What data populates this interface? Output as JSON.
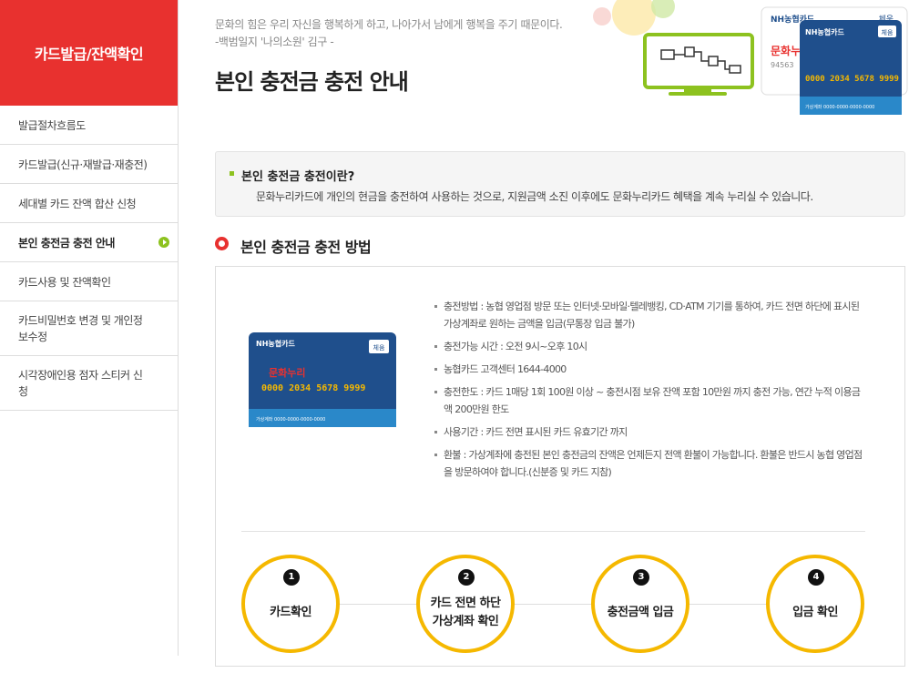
{
  "sidebar": {
    "title": "카드발급/잔액확인",
    "items": [
      {
        "label": "발급절차흐름도"
      },
      {
        "label": "카드발급(신규·재발급·재충전)"
      },
      {
        "label": "세대별 카드 잔액 합산 신청"
      },
      {
        "label": "본인 충전금 충전 안내"
      },
      {
        "label": "카드사용 및 잔액확인"
      },
      {
        "label": "카드비밀번호 변경 및 개인정보수정"
      },
      {
        "label": "시각장애인용 점자 스티커 신청"
      }
    ]
  },
  "header": {
    "quote_line1": "문화의 힘은 우리 자신을 행복하게 하고, 나아가서 남에게 행복을 주기 때문이다.",
    "quote_line2": "-백범일지 '나의소원' 김구 -",
    "page_title": "본인 충전금 충전 안내"
  },
  "hero": {
    "card_bank": "NH농협카드",
    "card_brand": "문화누리",
    "card_number": "0000 2034 5678 9999",
    "card_chip": "체움",
    "card_sub": "가상계좌 0000-0000-0000-0000",
    "back_number": "94563"
  },
  "intro": {
    "question": "본인 충전금 충전이란?",
    "answer": "문화누리카드에 개인의 현금을 충전하여 사용하는 것으로, 지원금액 소진 이후에도 문화누리카드 혜택을 계속 누리실 수 있습니다."
  },
  "section": {
    "title": "본인 충전금 충전 방법"
  },
  "card": {
    "bank": "NH농협카드",
    "brand": "문화누리",
    "number": "0000 2034 5678 9999",
    "chip": "체움",
    "sub": "가상계좌 0000-0000-0000-0000"
  },
  "bullets": [
    "충전방법 : 농협 영업점 방문 또는 인터넷·모바일·텔레뱅킹, CD·ATM 기기를 통하여, 카드 전면 하단에 표시된 가상계좌로 원하는 금액을 입금(무통장 입금 불가)",
    "충전가능 시간 : 오전 9시~오후 10시",
    "농협카드 고객센터 1644-4000",
    "충전한도 : 카드 1매당 1회 100원 이상 ~ 충전시점 보유 잔액 포함 10만원 까지 충전 가능, 연간 누적 이용금액 200만원 한도",
    "사용기간 : 카드 전면 표시된 카드 유효기간 까지",
    "환불 : 가상계좌에 충전된 본인 충전금의 잔액은 언제든지 전액 환불이 가능합니다. 환불은 반드시 농협 영업점을 방문하여야 합니다.(신분증 및 카드 지참)"
  ],
  "steps": [
    {
      "num": "1",
      "label": "카드확인"
    },
    {
      "num": "2",
      "label": "카드 전면 하단 가상계좌 확인"
    },
    {
      "num": "3",
      "label": "충전금액 입금"
    },
    {
      "num": "4",
      "label": "입금 확인"
    }
  ],
  "colors": {
    "accent": "#e8312f",
    "green": "#8dc21f",
    "step_ring": "#f5b800",
    "card_blue": "#1f4f8c"
  }
}
